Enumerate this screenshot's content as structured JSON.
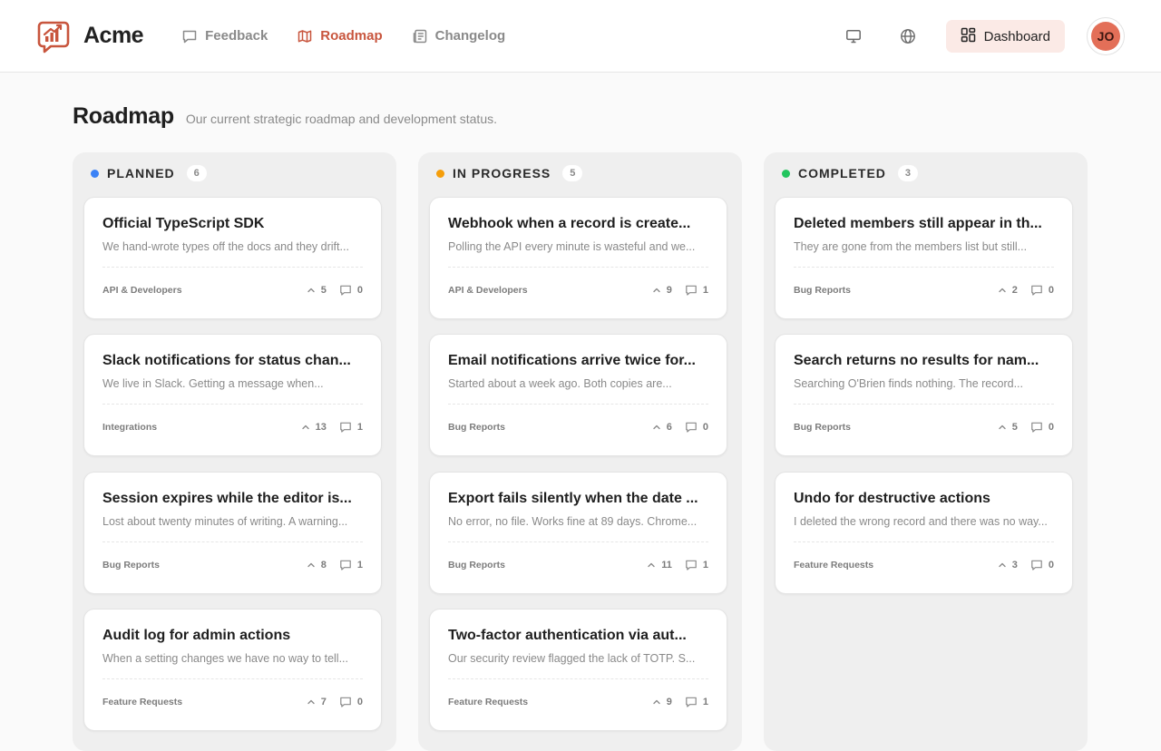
{
  "brand": {
    "name": "Acme",
    "logo_icon": "chart-chat-logo-icon",
    "accent": "#c8553d"
  },
  "nav": [
    {
      "label": "Feedback",
      "icon": "chat-bubble-icon",
      "active": false
    },
    {
      "label": "Roadmap",
      "icon": "map-icon",
      "active": true
    },
    {
      "label": "Changelog",
      "icon": "newspaper-icon",
      "active": false
    }
  ],
  "header": {
    "monitor_icon": "monitor-icon",
    "globe_icon": "globe-icon",
    "dashboard_label": "Dashboard",
    "avatar_initials": "JO"
  },
  "page": {
    "title": "Roadmap",
    "subtitle": "Our current strategic roadmap and development status."
  },
  "columns": [
    {
      "title": "PLANNED",
      "count": "6",
      "color": "#3b82f6",
      "cards": [
        {
          "title": "Official TypeScript SDK",
          "desc": "We hand-wrote types off the docs and they drift...",
          "tag": "API & Developers",
          "votes": "5",
          "comments": "0"
        },
        {
          "title": "Slack notifications for status chan...",
          "desc": "We live in Slack. Getting a message when...",
          "tag": "Integrations",
          "votes": "13",
          "comments": "1"
        },
        {
          "title": "Session expires while the editor is...",
          "desc": "Lost about twenty minutes of writing. A warning...",
          "tag": "Bug Reports",
          "votes": "8",
          "comments": "1"
        },
        {
          "title": "Audit log for admin actions",
          "desc": "When a setting changes we have no way to tell...",
          "tag": "Feature Requests",
          "votes": "7",
          "comments": "0"
        }
      ]
    },
    {
      "title": "IN PROGRESS",
      "count": "5",
      "color": "#f59e0b",
      "cards": [
        {
          "title": "Webhook when a record is create...",
          "desc": "Polling the API every minute is wasteful and we...",
          "tag": "API & Developers",
          "votes": "9",
          "comments": "1"
        },
        {
          "title": "Email notifications arrive twice for...",
          "desc": "Started about a week ago. Both copies are...",
          "tag": "Bug Reports",
          "votes": "6",
          "comments": "0"
        },
        {
          "title": "Export fails silently when the date ...",
          "desc": "No error, no file. Works fine at 89 days. Chrome...",
          "tag": "Bug Reports",
          "votes": "11",
          "comments": "1"
        },
        {
          "title": "Two-factor authentication via aut...",
          "desc": "Our security review flagged the lack of TOTP. S...",
          "tag": "Feature Requests",
          "votes": "9",
          "comments": "1"
        }
      ]
    },
    {
      "title": "COMPLETED",
      "count": "3",
      "color": "#22c55e",
      "cards": [
        {
          "title": "Deleted members still appear in th...",
          "desc": "They are gone from the members list but still...",
          "tag": "Bug Reports",
          "votes": "2",
          "comments": "0"
        },
        {
          "title": "Search returns no results for nam...",
          "desc": "Searching O'Brien finds nothing. The record...",
          "tag": "Bug Reports",
          "votes": "5",
          "comments": "0"
        },
        {
          "title": "Undo for destructive actions",
          "desc": "I deleted the wrong record and there was no way...",
          "tag": "Feature Requests",
          "votes": "3",
          "comments": "0"
        }
      ]
    }
  ]
}
